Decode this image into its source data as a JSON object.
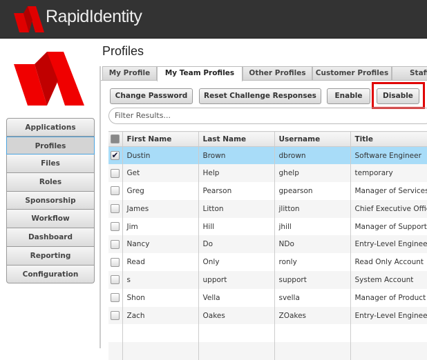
{
  "app": {
    "title": "RapidIdentity",
    "brand_color": "#e00000"
  },
  "page": {
    "title": "Profiles"
  },
  "sidebar": {
    "items": [
      {
        "label": "Applications"
      },
      {
        "label": "Profiles",
        "active": true
      },
      {
        "label": "Files"
      },
      {
        "label": "Roles"
      },
      {
        "label": "Sponsorship"
      },
      {
        "label": "Workflow"
      },
      {
        "label": "Dashboard"
      },
      {
        "label": "Reporting"
      },
      {
        "label": "Configuration"
      }
    ]
  },
  "tabs": [
    {
      "label": "My Profile"
    },
    {
      "label": "My Team Profiles",
      "active": true
    },
    {
      "label": "Other Profiles"
    },
    {
      "label": "Customer Profiles"
    },
    {
      "label": "Staff"
    }
  ],
  "toolbar": {
    "change_password": "Change Password",
    "reset_challenge": "Reset Challenge Responses",
    "enable": "Enable",
    "disable": "Disable"
  },
  "filter": {
    "placeholder": "Filter Results..."
  },
  "table": {
    "columns": [
      "First Name",
      "Last Name",
      "Username",
      "Title"
    ],
    "rows": [
      {
        "first": "Dustin",
        "last": "Brown",
        "username": "dbrown",
        "title": "Software Engineer",
        "checked": true
      },
      {
        "first": "Get",
        "last": "Help",
        "username": "ghelp",
        "title": "temporary"
      },
      {
        "first": "Greg",
        "last": "Pearson",
        "username": "gpearson",
        "title": "Manager of Services"
      },
      {
        "first": "James",
        "last": "Litton",
        "username": "jlitton",
        "title": "Chief Executive Officer"
      },
      {
        "first": "Jim",
        "last": "Hill",
        "username": "jhill",
        "title": "Manager of Support"
      },
      {
        "first": "Nancy",
        "last": "Do",
        "username": "NDo",
        "title": "Entry-Level Engineer"
      },
      {
        "first": "Read",
        "last": "Only",
        "username": "ronly",
        "title": "Read Only Account"
      },
      {
        "first": "s",
        "last": "upport",
        "username": "support",
        "title": "System Account"
      },
      {
        "first": "Shon",
        "last": "Vella",
        "username": "svella",
        "title": "Manager of Product"
      },
      {
        "first": "Zach",
        "last": "Oakes",
        "username": "ZOakes",
        "title": "Entry-Level Engineer"
      }
    ]
  }
}
